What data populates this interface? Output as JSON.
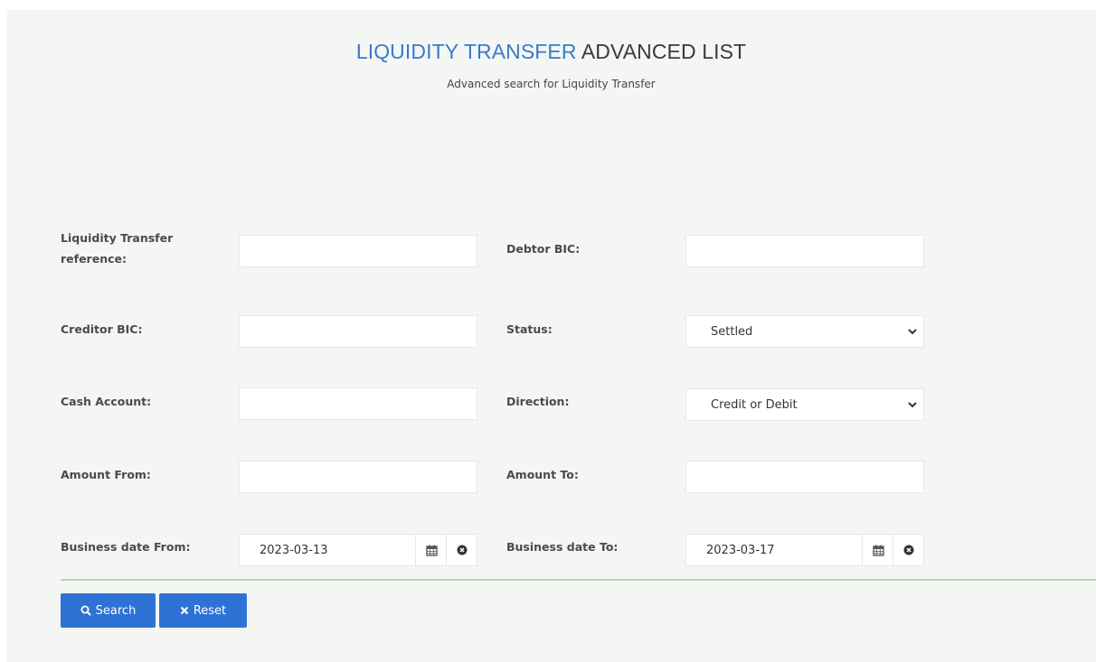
{
  "header": {
    "title_accent": "LIQUIDITY TRANSFER",
    "title_rest": " ADVANCED LIST",
    "subtitle": "Advanced search for Liquidity Transfer"
  },
  "form": {
    "lt_reference": {
      "label": "Liquidity Transfer reference:",
      "value": ""
    },
    "debtor_bic": {
      "label": "Debtor BIC:",
      "value": ""
    },
    "creditor_bic": {
      "label": "Creditor BIC:",
      "value": ""
    },
    "status": {
      "label": "Status:",
      "selected": "Settled"
    },
    "cash_account": {
      "label": "Cash Account:",
      "value": ""
    },
    "direction": {
      "label": "Direction:",
      "selected": "Credit or Debit"
    },
    "amount_from": {
      "label": "Amount From:",
      "value": ""
    },
    "amount_to": {
      "label": "Amount To:",
      "value": ""
    },
    "business_date_from": {
      "label": "Business date From:",
      "value": "2023-03-13"
    },
    "business_date_to": {
      "label": "Business date To:",
      "value": "2023-03-17"
    }
  },
  "actions": {
    "search_label": "Search",
    "reset_label": "Reset"
  },
  "icons": {
    "search": "search-icon",
    "reset": "times-icon",
    "calendar": "calendar-icon",
    "clear": "clear-circle-icon",
    "chevron": "chevron-down-icon"
  },
  "colors": {
    "accent": "#3d7ac8",
    "button": "#2f72d6",
    "panel_bg": "#f4f6f4",
    "divider": "#b9d4b8"
  }
}
